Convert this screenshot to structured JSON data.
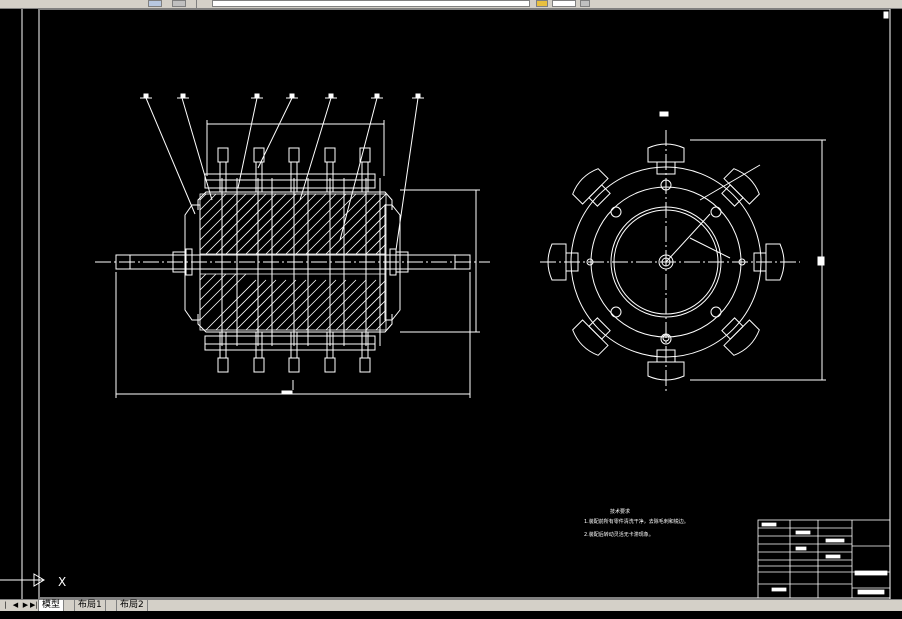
{
  "toolbar": {
    "items": [
      "layer-button",
      "save-button",
      "layer-dropdown",
      "color-dropdown",
      "properties-button",
      "close-button"
    ]
  },
  "tabs": [
    {
      "label": "模型"
    },
    {
      "label": "布局1"
    },
    {
      "label": "布局2"
    }
  ],
  "ucs": {
    "x_label": "X"
  },
  "drawing": {
    "tech_notes_title": "技术要求",
    "tech_notes": [
      "1.装配前所有零件清洗干净，去除毛刺和锐边。",
      "2.装配后转动灵活无卡滞现象。"
    ],
    "colors": {
      "background": "#000000",
      "lines": "#ffffff"
    }
  }
}
